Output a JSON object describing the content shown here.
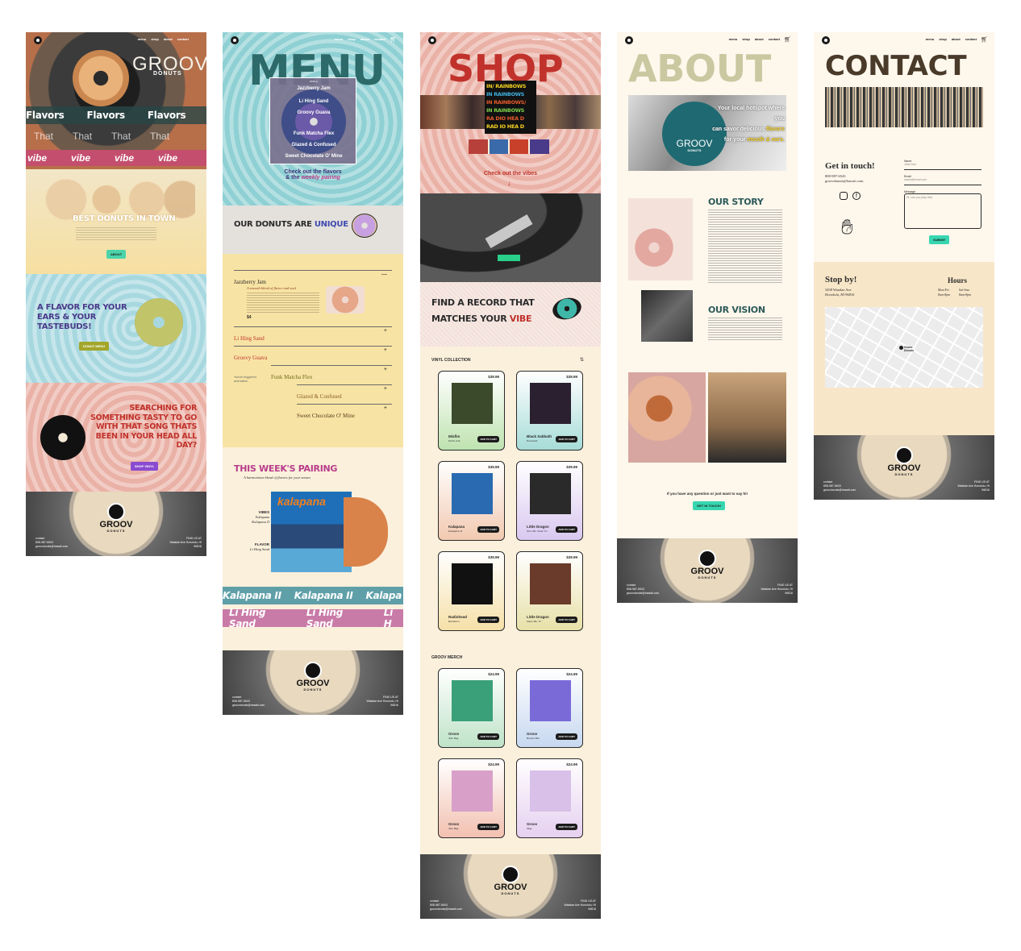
{
  "nav": {
    "menu": "menu",
    "shop": "shop",
    "about": "about",
    "contact": "contact"
  },
  "home": {
    "hero_brand": "GROOV",
    "hero_brand_sub": "DONUTS",
    "marquee_flavors": [
      "Flavors",
      "Flavors",
      "Flavors"
    ],
    "marquee_that": [
      "That",
      "That",
      "That",
      "That",
      "That"
    ],
    "marquee_vibe": [
      "vibe",
      "vibe",
      "vibe",
      "vibe",
      "vibe"
    ],
    "best_title": "BEST DONUTS IN TOWN",
    "about_button": "ABOUT",
    "flavor_title": "A FLAVOR FOR YOUR EARS & YOUR TASTEBUDS!",
    "donut_menu_button": "DONUT MENU",
    "search_title": "SEARCHING FOR SOMETHING TASTY TO GO WITH THAT SONG THATS BEEN IN YOUR HEAD ALL DAY?",
    "shop_vinyl_button": "SHOP VINYL"
  },
  "menu_page": {
    "title": "MENU",
    "week_badge": "DISH A",
    "wheel_items": [
      "Jazzberry Jam",
      "Li Hing Sand",
      "Groovy Guava",
      "Funk Matcha Flex",
      "Glazed & Confused",
      "Sweet Chocolate O' Mine"
    ],
    "check_flavors": "Check out the flavors",
    "and_the": "& the",
    "weekly_pairing": "weekly pairing",
    "unique_title_a": "OUR DONUTS ARE",
    "unique_title_b": "UNIQUE",
    "accordion": [
      "Jazzberry Jam",
      "Li Hing Sand",
      "Groovy Guava",
      "Funk Matcha Flex",
      "Glazed & Confused",
      "Sweet Chocolate O' Mine"
    ],
    "jazz_tagline": "A smooth blend of flavor and soul",
    "jazz_price": "$4",
    "scroll_note": "*scroll triggered animation",
    "pairing_title": "THIS WEEK'S PAIRING",
    "pairing_sub": "A harmonious blend of flavors for your senses",
    "vibes_label": "VIBES",
    "vibes_artist": "Kalapana",
    "vibes_album": "Kalapana II",
    "flavor_label": "FLAVOR",
    "flavor_value": "Li Hing Sand",
    "album_art_text": "kalapana",
    "marquee_kalapana": [
      "Kalapana II",
      "Kalapana II",
      "Kalapa"
    ],
    "marquee_lihing": [
      "Li Hing Sand",
      "Li Hing Sand",
      "Li H"
    ]
  },
  "shop_page": {
    "title": "SHOP",
    "check_vibes": "Check out the vibes",
    "rainbow_lines": [
      "IN/ RAINBOWS",
      "IN RAINBOWS",
      "IN RAINBOWS/",
      "IN RAINBOWS",
      "RA DIO HEA D",
      "RAD IO HEA D"
    ],
    "find_title_a": "FIND A RECORD THAT",
    "find_title_b": "MATCHES YOUR",
    "find_title_c": "VIBE",
    "vinyl_heading": "VINYL COLLECTION",
    "merch_heading": "GROOV MERCH",
    "add_to_cart": "ADD TO CART",
    "vinyl": [
      {
        "name": "Misfits",
        "sub": "Earth A.D.",
        "price": "$39.99"
      },
      {
        "name": "Black Sabbath",
        "sub": "Paranoid",
        "price": "$39.99"
      },
      {
        "name": "Kalapana",
        "sub": "Kalapana II",
        "price": "$39.99"
      },
      {
        "name": "Little Dragon",
        "sub": "New Me, Same Us",
        "price": "$39.99"
      },
      {
        "name": "Radiohead",
        "sub": "Rainbows",
        "price": "$39.99"
      },
      {
        "name": "Little Dragon",
        "sub": "Same Me, Ur",
        "price": "$39.99"
      }
    ],
    "merch": [
      {
        "name": "Groov",
        "sub": "Tote Bag",
        "price": "$24.99"
      },
      {
        "name": "Groov",
        "sub": "Bucket Hat",
        "price": "$24.99"
      },
      {
        "name": "Groov",
        "sub": "Tote Bag",
        "price": "$24.99"
      },
      {
        "name": "Groov",
        "sub": "Mug",
        "price": "$24.99"
      }
    ]
  },
  "about_page": {
    "title": "ABOUT",
    "hero_text_a": "Your local hotspot where you",
    "hero_text_b": "can savor delicious",
    "hero_text_flavors": "flavors",
    "hero_text_c": "for your",
    "hero_text_mouth": "mouth & ears.",
    "sign_brand": "GROOV",
    "sign_sub": "DONUTS",
    "story_title": "OUR STORY",
    "vision_title": "OUR VISION",
    "question": "If you have any question or just want to say hi!",
    "get_in_touch_button": "GET IN TOUCH!"
  },
  "contact_page": {
    "title": "CONTACT",
    "get_in_touch": "Get in touch!",
    "phone": "808-987-6543",
    "email": "groovdonuts@hawaii.com",
    "form_name_label": "Name",
    "form_email_label": "Email",
    "form_message_label": "Message",
    "form_name_placeholder": "Jane Doe",
    "form_email_placeholder": "name@email.com",
    "form_message_placeholder": "Hi, can you play that",
    "submit": "SUBMIT",
    "stop_by": "Stop by!",
    "address_a": "3458 Waialae Ave",
    "address_b": "Honolulu, HI 96816",
    "hours_title": "Hours",
    "hours_days_a": "Mon-Fri",
    "hours_days_b": "Sat-Sun",
    "hours_time_a": "8am-8pm",
    "hours_time_b": "8am-8pm",
    "map_label_a": "Groov",
    "map_label_b": "Donuts"
  },
  "footer": {
    "brand": "GROOV",
    "brand_sub": "DONUTS",
    "contact_label": "contact",
    "phone": "808-987-6543",
    "email": "groovdonuts@hawaii.com",
    "find_us": "FIND US AT",
    "address": "Waialae Ave Honolulu, HI 96816"
  },
  "colors": {
    "menu_teal": "#8ed0d3",
    "cream": "#fbf0dc",
    "butter": "#f7e3a3",
    "pink": "#eab1a6",
    "mint": "#37d6b0",
    "shop_red": "#c0322b",
    "about_olive": "#c9c8a0"
  }
}
